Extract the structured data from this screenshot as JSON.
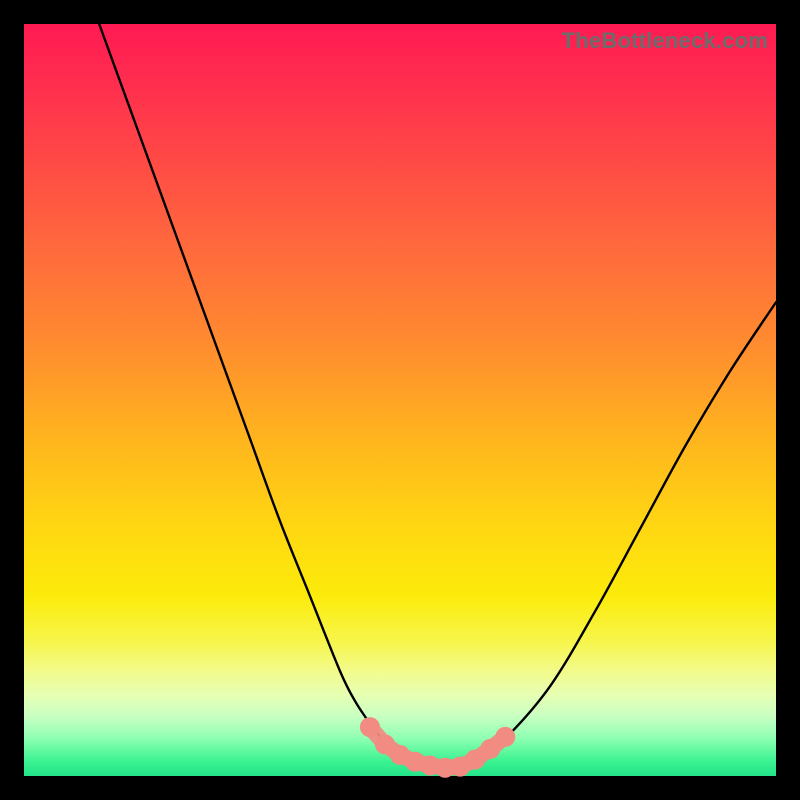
{
  "watermark": "TheBottleneck.com",
  "colors": {
    "frame": "#000000",
    "curve": "#000000",
    "marker": "#f28b82",
    "gradient_top": "#ff1a52",
    "gradient_bottom": "#23e38a"
  },
  "chart_data": {
    "type": "line",
    "title": "",
    "xlabel": "",
    "ylabel": "",
    "xlim": [
      0,
      100
    ],
    "ylim": [
      0,
      100
    ],
    "grid": false,
    "legend": false,
    "series": [
      {
        "name": "bottleneck-curve",
        "x": [
          10,
          14,
          18,
          22,
          26,
          30,
          34,
          38,
          42,
          44,
          46,
          48,
          50,
          52,
          54,
          56,
          58,
          60,
          64,
          70,
          76,
          82,
          88,
          94,
          100
        ],
        "y": [
          100,
          89,
          78,
          67,
          56,
          45,
          34,
          24,
          14,
          10,
          7,
          4.5,
          3,
          2,
          1.4,
          1.1,
          1.2,
          2,
          5,
          12,
          22,
          33,
          44,
          54,
          63
        ]
      }
    ],
    "markers": {
      "name": "optimal-range",
      "x": [
        46,
        48,
        50,
        52,
        54,
        56,
        58,
        60,
        62,
        64
      ],
      "y": [
        6.5,
        4.2,
        2.8,
        1.9,
        1.4,
        1.1,
        1.25,
        2.2,
        3.6,
        5.2
      ]
    }
  }
}
